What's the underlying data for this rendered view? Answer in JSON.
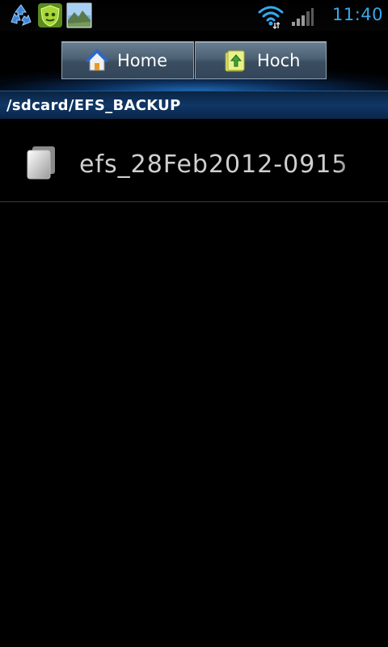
{
  "status_bar": {
    "time": "11:40",
    "icons": [
      "recycle-icon",
      "shield-icon",
      "photo-icon",
      "wifi-icon",
      "signal-icon"
    ],
    "time_color": "#35a9ec"
  },
  "toolbar": {
    "home_label": "Home",
    "up_label": "Hoch"
  },
  "path": {
    "current": "/sdcard/EFS_BACKUP"
  },
  "files": [
    {
      "name": "efs_28Feb2012-0915",
      "icon": "file-icon"
    }
  ],
  "colors": {
    "accent": "#1e66b0",
    "path_bar": "#0f3766",
    "file_text": "#cfcfcf"
  }
}
